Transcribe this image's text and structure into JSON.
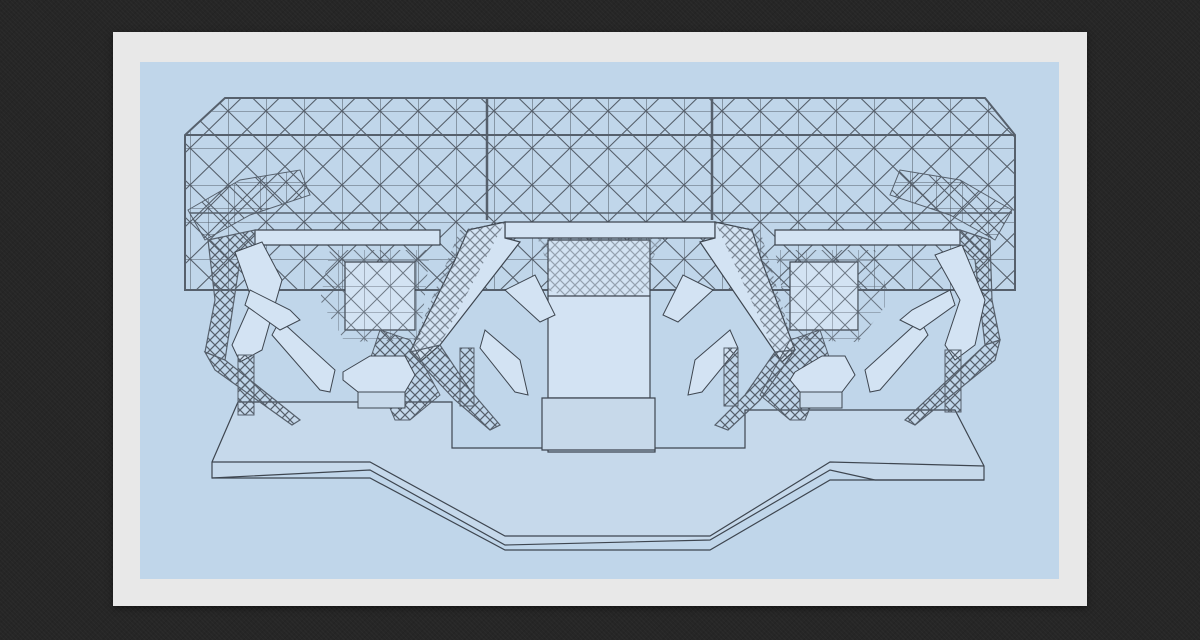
{
  "image": {
    "subject": "stage-truss-render"
  },
  "colors": {
    "page_background": "#262626",
    "frame": "#e8e8e8",
    "scene_background": "#c0d6ea",
    "truss_line": "#56606c",
    "truss_fill": "#b3c6d9",
    "floor_fill": "#c6d9eb",
    "box_fill": "#d3e3f3",
    "outline": "#3e4650"
  }
}
